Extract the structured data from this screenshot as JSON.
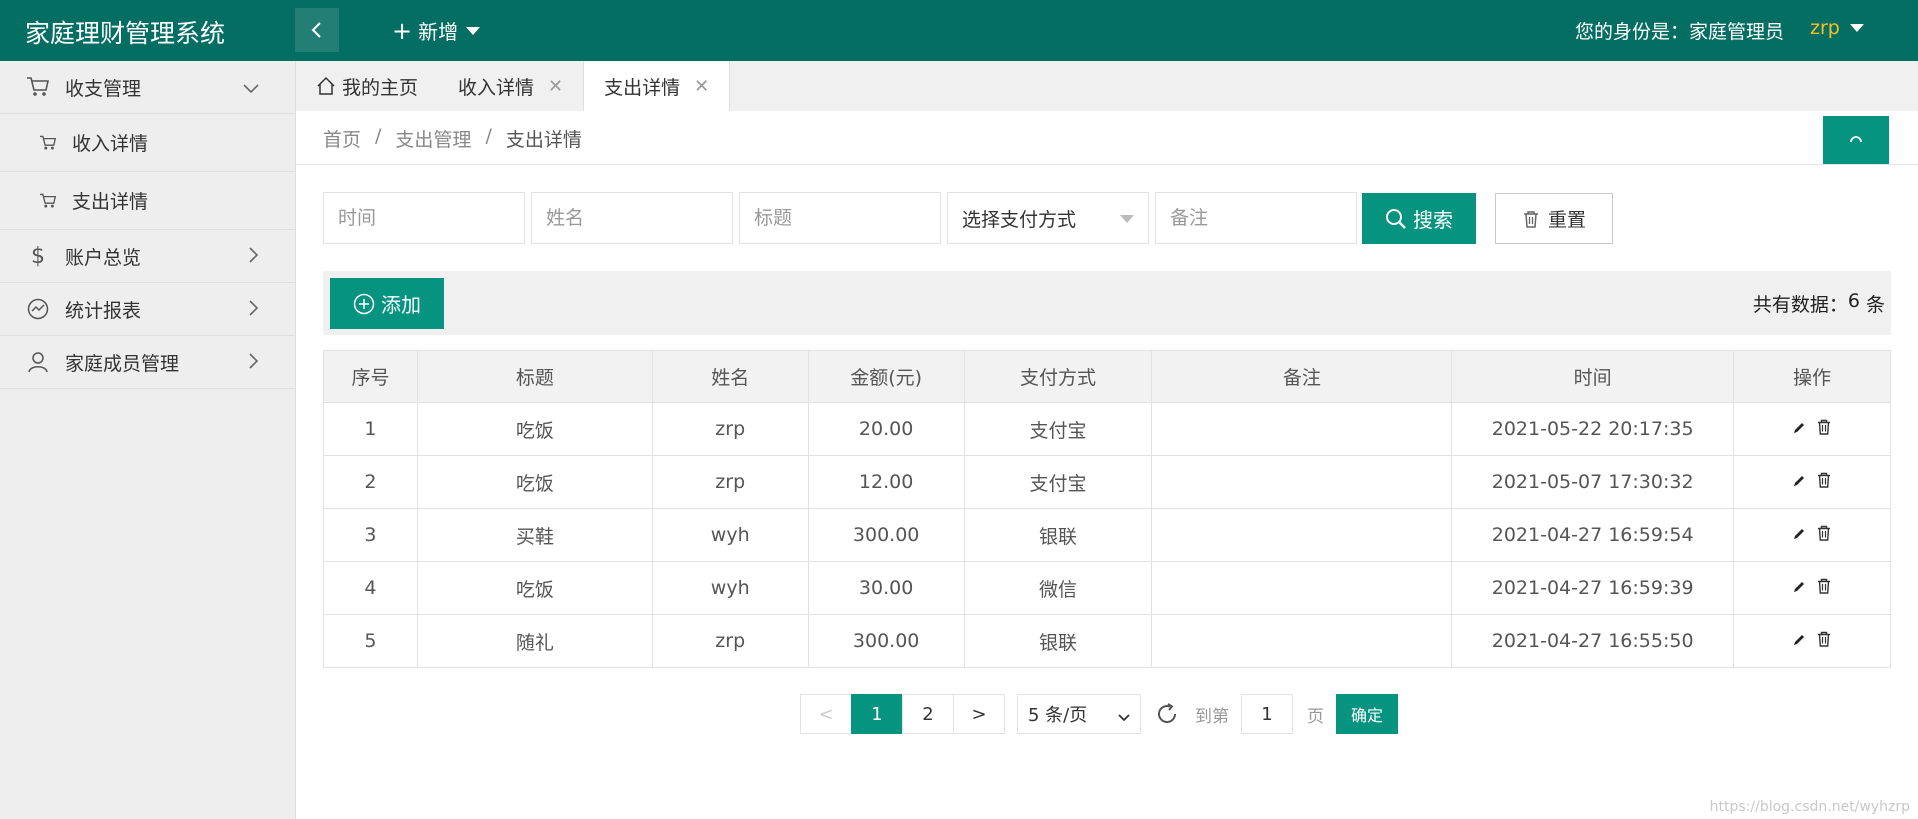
{
  "header": {
    "app_title": "家庭理财管理系统",
    "new_menu_label": "新增",
    "identity_label": "您的身份是：家庭管理员",
    "username": "zrp"
  },
  "sidebar": {
    "groups": [
      {
        "label": "收支管理",
        "icon": "cart-icon",
        "expanded": true,
        "children": [
          {
            "label": "收入详情"
          },
          {
            "label": "支出详情"
          }
        ]
      },
      {
        "label": "账户总览",
        "icon": "dollar-icon"
      },
      {
        "label": "统计报表",
        "icon": "chart-icon"
      },
      {
        "label": "家庭成员管理",
        "icon": "user-icon"
      }
    ]
  },
  "tabs": [
    {
      "label": "我的主页",
      "closable": false
    },
    {
      "label": "收入详情",
      "closable": true
    },
    {
      "label": "支出详情",
      "closable": true,
      "active": true
    }
  ],
  "breadcrumb": [
    "首页",
    "支出管理",
    "支出详情"
  ],
  "search": {
    "time_placeholder": "时间",
    "name_placeholder": "姓名",
    "title_placeholder": "标题",
    "payment_select": "选择支付方式",
    "remark_placeholder": "备注",
    "search_label": "搜索",
    "reset_label": "重置"
  },
  "toolbar": {
    "add_label": "添加",
    "total_label": "共有数据：",
    "total_count": "6",
    "total_unit": " 条"
  },
  "table": {
    "columns": [
      "序号",
      "标题",
      "姓名",
      "金额(元)",
      "支付方式",
      "备注",
      "时间",
      "操作"
    ],
    "rows": [
      [
        "1",
        "吃饭",
        "zrp",
        "20.00",
        "支付宝",
        "",
        "2021-05-22 20:17:35"
      ],
      [
        "2",
        "吃饭",
        "zrp",
        "12.00",
        "支付宝",
        "",
        "2021-05-07 17:30:32"
      ],
      [
        "3",
        "买鞋",
        "wyh",
        "300.00",
        "银联",
        "",
        "2021-04-27 16:59:54"
      ],
      [
        "4",
        "吃饭",
        "wyh",
        "30.00",
        "微信",
        "",
        "2021-04-27 16:59:39"
      ],
      [
        "5",
        "随礼",
        "zrp",
        "300.00",
        "银联",
        "",
        "2021-04-27 16:55:50"
      ]
    ]
  },
  "pagination": {
    "prev": "<",
    "pages": [
      "1",
      "2"
    ],
    "current": "1",
    "next": ">",
    "limit_label": "5 条/页",
    "goto_label": "到第",
    "goto_value": "1",
    "page_unit": "页",
    "confirm_label": "确定"
  },
  "watermark": "https://blog.csdn.net/wyhzrp",
  "colors": {
    "header": "#056e63",
    "accent": "#069481",
    "username": "#fbbf24"
  }
}
